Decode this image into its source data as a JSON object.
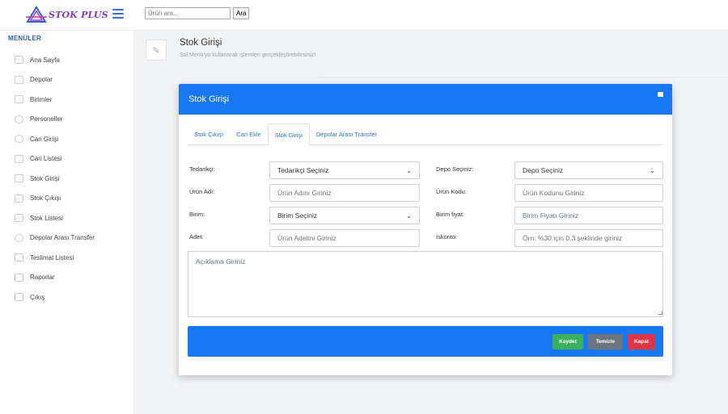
{
  "app": {
    "logo_text": "STOK PLUS"
  },
  "search": {
    "placeholder": "Ürün ara...",
    "button_label": "Ara"
  },
  "sidebar": {
    "title": "MENÜLER",
    "items": [
      {
        "label": "Ana Sayfa",
        "icon": "home-icon"
      },
      {
        "label": "Depolar",
        "icon": "warehouse-icon"
      },
      {
        "label": "Birimler",
        "icon": "box-icon"
      },
      {
        "label": "Personeller",
        "icon": "users-icon"
      },
      {
        "label": "Cari Girişi",
        "icon": "user-add-icon"
      },
      {
        "label": "Cari Listesi",
        "icon": "list-icon"
      },
      {
        "label": "Stok Girişi",
        "icon": "pen-icon"
      },
      {
        "label": "Stok Çıkışı",
        "icon": "clipboard-icon"
      },
      {
        "label": "Stok Listesi",
        "icon": "clipboard-list-icon"
      },
      {
        "label": "Depolar Arası Transfer",
        "icon": "share-icon"
      },
      {
        "label": "Teslimat Listesi",
        "icon": "document-icon"
      },
      {
        "label": "Raporlar",
        "icon": "chart-icon"
      },
      {
        "label": "Çıkış",
        "icon": "lock-icon"
      }
    ]
  },
  "page": {
    "title": "Stok Girişi",
    "subtitle": "Sol Menü'yü kullanarak işlemleri gerçekleştirebilirsiniz!"
  },
  "card": {
    "title": "Stok Girişi",
    "tabs": [
      {
        "label": "Stok Çıkışı",
        "active": false
      },
      {
        "label": "Cari Ekle",
        "active": false
      },
      {
        "label": "Stok Girişi",
        "active": true
      },
      {
        "label": "Depolar Arası Transfer",
        "active": false
      }
    ],
    "form": {
      "supplier_label": "Tedarikçi:",
      "supplier_value": "Tedarikçi Seçiniz",
      "warehouse_label": "Depo Seçiniz:",
      "warehouse_value": "Depo Seçiniz",
      "product_name_label": "Ürün Adı:",
      "product_name_placeholder": "Ürün Adını Giriniz",
      "product_code_label": "Ürün Kodu:",
      "product_code_placeholder": "Ürün Kodunu Giriniz",
      "unit_label": "Birim:",
      "unit_value": "Birim Seçiniz",
      "unit_price_label": "Birim fiyat:",
      "unit_price_placeholder": "Birim Fiyatı Giriniz",
      "quantity_label": "Adet:",
      "quantity_placeholder": "Ürün Adetini Giriniz",
      "discount_label": "İskonto:",
      "discount_placeholder": "Örn: %30 için 0.3 şeklinde giriniz",
      "description_placeholder": "Açıklama Giriniz"
    },
    "buttons": {
      "save": "Kaydet",
      "clear": "Temizle",
      "close": "Kapat"
    }
  },
  "colors": {
    "primary": "#1877f2",
    "success": "#3bb15d",
    "secondary": "#6c757d",
    "danger": "#dc3545",
    "logo": "#7d3cc9"
  }
}
